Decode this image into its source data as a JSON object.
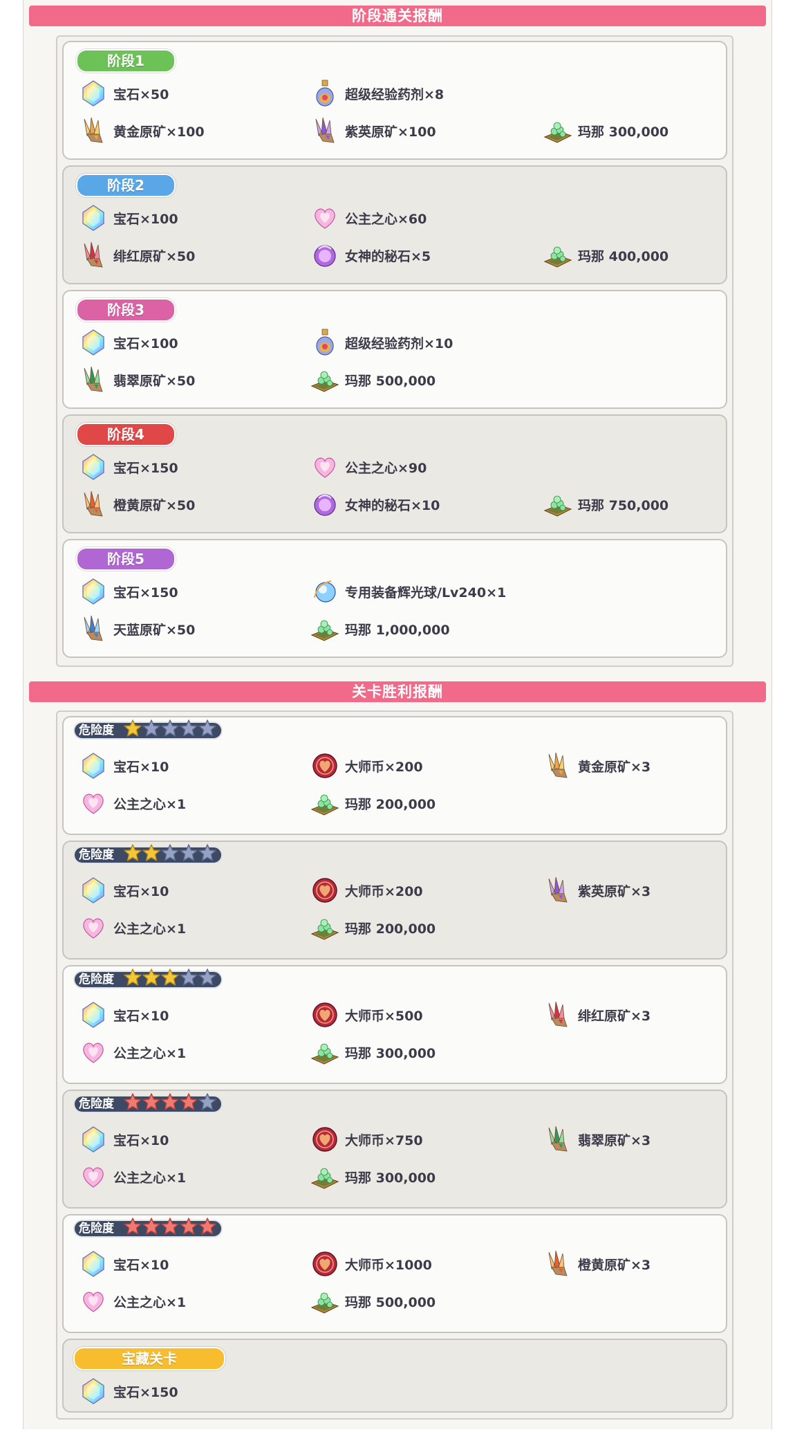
{
  "sections": {
    "stage_rewards_title": "阶段通关报酬",
    "victory_rewards_title": "关卡胜利报酬"
  },
  "colors": {
    "section_bar": "#f26a8a",
    "stage1": "#6cc257",
    "stage2": "#5aa7e8",
    "stage3": "#dc62a6",
    "stage4": "#e04848",
    "stage5": "#b067d4",
    "treasure": "#f7bd2e",
    "star_gold": "#f4c63a",
    "star_red": "#f07a72",
    "star_gray": "#95a2c4"
  },
  "stages": [
    {
      "label": "阶段1",
      "items": [
        {
          "icon": "gem-icon",
          "text": "宝石×50"
        },
        {
          "icon": "exp-potion-icon",
          "text": "超级经验药剂×8"
        },
        {
          "icon": "gold-ore-icon",
          "text": "黄金原矿×100"
        },
        {
          "icon": "purple-ore-icon",
          "text": "紫英原矿×100"
        },
        {
          "icon": "mana-icon",
          "text": "玛那 300,000"
        }
      ]
    },
    {
      "label": "阶段2",
      "items": [
        {
          "icon": "gem-icon",
          "text": "宝石×100"
        },
        {
          "icon": "princess-heart-icon",
          "text": "公主之心×60"
        },
        {
          "icon": "red-ore-icon",
          "text": "绯红原矿×50"
        },
        {
          "icon": "goddess-stone-icon",
          "text": "女神的秘石×5"
        },
        {
          "icon": "mana-icon",
          "text": "玛那 400,000"
        }
      ]
    },
    {
      "label": "阶段3",
      "items": [
        {
          "icon": "gem-icon",
          "text": "宝石×100"
        },
        {
          "icon": "exp-potion-icon",
          "text": "超级经验药剂×10"
        },
        {
          "icon": "green-ore-icon",
          "text": "翡翠原矿×50"
        },
        {
          "icon": "mana-icon",
          "text": "玛那 500,000"
        }
      ]
    },
    {
      "label": "阶段4",
      "items": [
        {
          "icon": "gem-icon",
          "text": "宝石×150"
        },
        {
          "icon": "princess-heart-icon",
          "text": "公主之心×90"
        },
        {
          "icon": "orange-ore-icon",
          "text": "橙黄原矿×50"
        },
        {
          "icon": "goddess-stone-icon",
          "text": "女神的秘石×10"
        },
        {
          "icon": "mana-icon",
          "text": "玛那 750,000"
        }
      ]
    },
    {
      "label": "阶段5",
      "items": [
        {
          "icon": "gem-icon",
          "text": "宝石×150"
        },
        {
          "icon": "glow-orb-icon",
          "text": "专用装备辉光球/Lv240×1"
        },
        {
          "icon": "blue-ore-icon",
          "text": "天蓝原矿×50"
        },
        {
          "icon": "mana-icon",
          "text": "玛那 1,000,000"
        }
      ]
    }
  ],
  "danger_label": "危险度",
  "victory": [
    {
      "stars_filled": 1,
      "star_color": "gold",
      "items": [
        {
          "icon": "gem-icon",
          "text": "宝石×10"
        },
        {
          "icon": "master-coin-icon",
          "text": "大师币×200"
        },
        {
          "icon": "gold-ore-icon",
          "text": "黄金原矿×3"
        },
        {
          "icon": "princess-heart-icon",
          "text": "公主之心×1"
        },
        {
          "icon": "mana-icon",
          "text": "玛那 200,000"
        }
      ]
    },
    {
      "stars_filled": 2,
      "star_color": "gold",
      "items": [
        {
          "icon": "gem-icon",
          "text": "宝石×10"
        },
        {
          "icon": "master-coin-icon",
          "text": "大师币×200"
        },
        {
          "icon": "purple-ore-icon",
          "text": "紫英原矿×3"
        },
        {
          "icon": "princess-heart-icon",
          "text": "公主之心×1"
        },
        {
          "icon": "mana-icon",
          "text": "玛那 200,000"
        }
      ]
    },
    {
      "stars_filled": 3,
      "star_color": "gold",
      "items": [
        {
          "icon": "gem-icon",
          "text": "宝石×10"
        },
        {
          "icon": "master-coin-icon",
          "text": "大师币×500"
        },
        {
          "icon": "red-ore-icon",
          "text": "绯红原矿×3"
        },
        {
          "icon": "princess-heart-icon",
          "text": "公主之心×1"
        },
        {
          "icon": "mana-icon",
          "text": "玛那 300,000"
        }
      ]
    },
    {
      "stars_filled": 4,
      "star_color": "red",
      "items": [
        {
          "icon": "gem-icon",
          "text": "宝石×10"
        },
        {
          "icon": "master-coin-icon",
          "text": "大师币×750"
        },
        {
          "icon": "green-ore-icon",
          "text": "翡翠原矿×3"
        },
        {
          "icon": "princess-heart-icon",
          "text": "公主之心×1"
        },
        {
          "icon": "mana-icon",
          "text": "玛那 300,000"
        }
      ]
    },
    {
      "stars_filled": 5,
      "star_color": "red",
      "items": [
        {
          "icon": "gem-icon",
          "text": "宝石×10"
        },
        {
          "icon": "master-coin-icon",
          "text": "大师币×1000"
        },
        {
          "icon": "orange-ore-icon",
          "text": "橙黄原矿×3"
        },
        {
          "icon": "princess-heart-icon",
          "text": "公主之心×1"
        },
        {
          "icon": "mana-icon",
          "text": "玛那 500,000"
        }
      ]
    }
  ],
  "treasure": {
    "label": "宝藏关卡",
    "items": [
      {
        "icon": "gem-icon",
        "text": "宝石×150"
      }
    ]
  }
}
